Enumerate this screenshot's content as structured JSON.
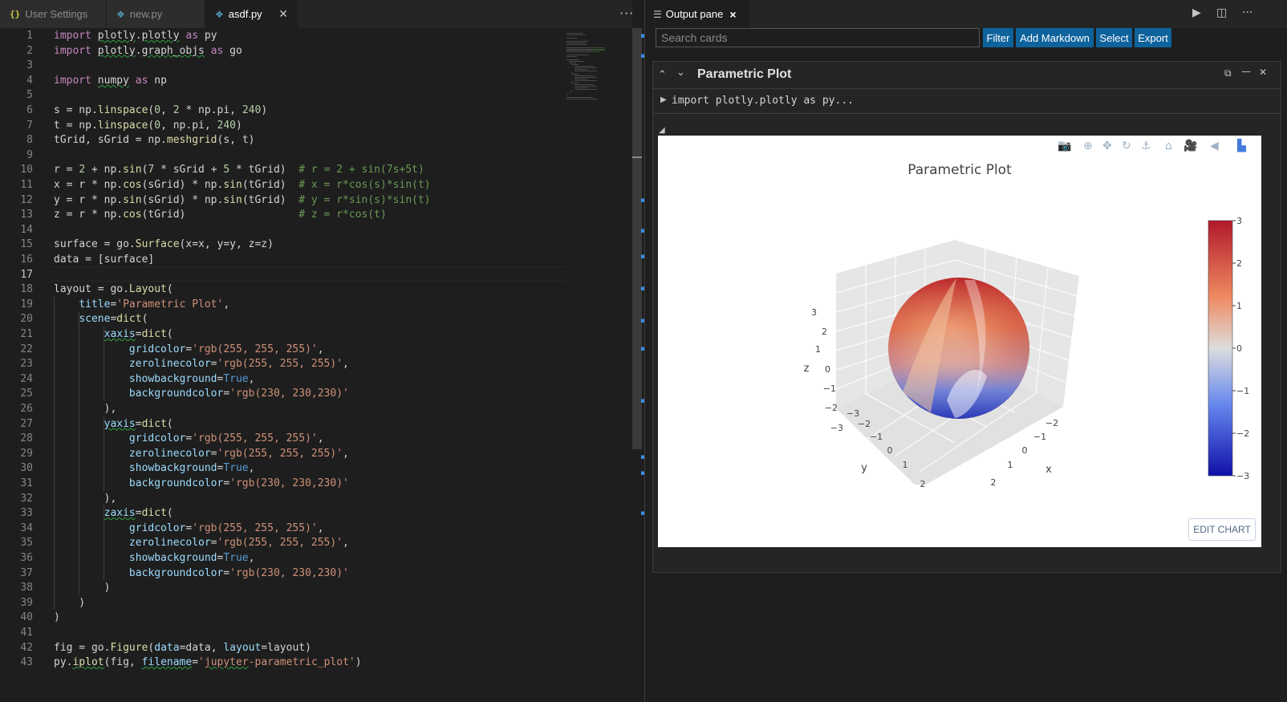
{
  "editor": {
    "tabs": [
      {
        "label": "User Settings",
        "icon": "json-braces-icon"
      },
      {
        "label": "new.py",
        "icon": "python-icon"
      },
      {
        "label": "asdf.py",
        "icon": "python-icon",
        "active": true
      }
    ],
    "more_label": "···",
    "current_line": 17,
    "code_lines": [
      "import plotly.plotly as py",
      "import plotly.graph_objs as go",
      "",
      "import numpy as np",
      "",
      "s = np.linspace(0, 2 * np.pi, 240)",
      "t = np.linspace(0, np.pi, 240)",
      "tGrid, sGrid = np.meshgrid(s, t)",
      "",
      "r = 2 + np.sin(7 * sGrid + 5 * tGrid)  # r = 2 + sin(7s+5t)",
      "x = r * np.cos(sGrid) * np.sin(tGrid)  # x = r*cos(s)*sin(t)",
      "y = r * np.sin(sGrid) * np.sin(tGrid)  # y = r*sin(s)*sin(t)",
      "z = r * np.cos(tGrid)                  # z = r*cos(t)",
      "",
      "surface = go.Surface(x=x, y=y, z=z)",
      "data = [surface]",
      "",
      "layout = go.Layout(",
      "    title='Parametric Plot',",
      "    scene=dict(",
      "        xaxis=dict(",
      "            gridcolor='rgb(255, 255, 255)',",
      "            zerolinecolor='rgb(255, 255, 255)',",
      "            showbackground=True,",
      "            backgroundcolor='rgb(230, 230,230)'",
      "        ),",
      "        yaxis=dict(",
      "            gridcolor='rgb(255, 255, 255)',",
      "            zerolinecolor='rgb(255, 255, 255)',",
      "            showbackground=True,",
      "            backgroundcolor='rgb(230, 230,230)'",
      "        ),",
      "        zaxis=dict(",
      "            gridcolor='rgb(255, 255, 255)',",
      "            zerolinecolor='rgb(255, 255, 255)',",
      "            showbackground=True,",
      "            backgroundcolor='rgb(230, 230,230)'",
      "        )",
      "    )",
      ")",
      "",
      "fig = go.Figure(data=data, layout=layout)",
      "py.iplot(fig, filename='jupyter-parametric_plot')"
    ]
  },
  "output": {
    "tab_label": "Output pane",
    "tab_close": "×",
    "actions": {
      "run": "▶",
      "split": "◫",
      "more": "···"
    },
    "search_placeholder": "Search cards",
    "buttons": {
      "filter": "Filter",
      "add_markdown": "Add Markdown",
      "select": "Select",
      "export": "Export"
    },
    "card": {
      "title": "Parametric Plot",
      "collapse": "⌃",
      "expand": "⌄",
      "code_preview": "import plotly.plotly as py...",
      "controls": {
        "popout": "⧉",
        "minimize": "—",
        "close": "✕"
      }
    },
    "edit_chart": "EDIT CHART"
  },
  "chart_data": {
    "type": "surface",
    "title": "Parametric Plot",
    "axes": {
      "x": {
        "label": "x",
        "ticks": [
          "−2",
          "−1",
          "0",
          "1",
          "2"
        ]
      },
      "y": {
        "label": "y",
        "ticks": [
          "−3",
          "−2",
          "−1",
          "0",
          "1",
          "2"
        ]
      },
      "z": {
        "label": "z",
        "ticks": [
          "−3",
          "−2",
          "−1",
          "0",
          "1",
          "2",
          "3"
        ]
      }
    },
    "colorbar": {
      "ticks": [
        "3",
        "2",
        "1",
        "0",
        "−1",
        "−2",
        "−3"
      ],
      "range": [
        -3,
        3
      ],
      "colorscale": [
        "#b2182b",
        "#ef8a62",
        "#dddddd",
        "#6688ee",
        "#1010a8"
      ]
    },
    "background": "rgb(230, 230,230)",
    "gridcolor": "rgb(255, 255, 255)"
  },
  "colors": {
    "accent": "#0e639c",
    "editor_bg": "#1e1e1e",
    "tab_bg": "#252526"
  }
}
